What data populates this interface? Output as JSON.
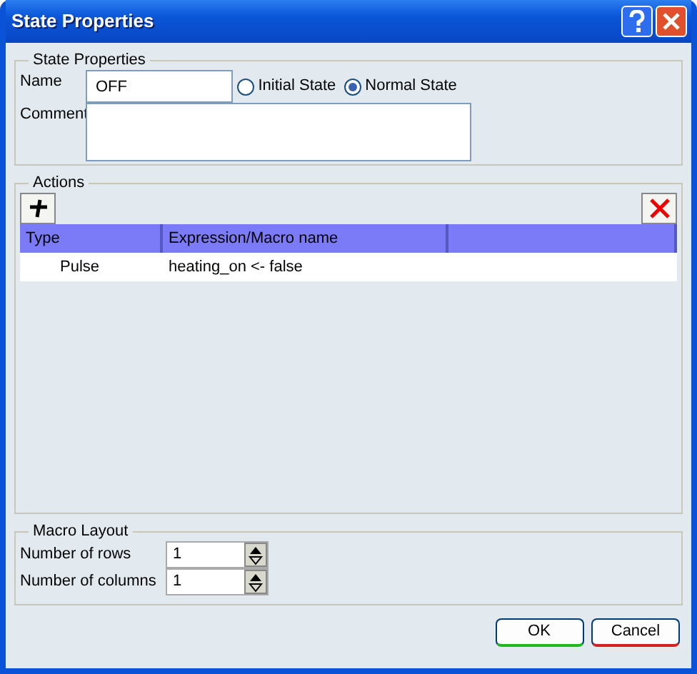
{
  "window": {
    "title": "State Properties"
  },
  "state_properties": {
    "title": "State Properties",
    "name_label": "Name",
    "name_value": "OFF",
    "comment_label": "Comment",
    "radios": [
      {
        "label": "Initial State",
        "selected": false
      },
      {
        "label": "Normal State",
        "selected": true
      }
    ]
  },
  "actions": {
    "title": "Actions",
    "columns": [
      "Type",
      "Expression/Macro name"
    ],
    "rows": [
      {
        "type": "Pulse",
        "expression": "heating_on <- false"
      }
    ]
  },
  "macro_layout": {
    "title": "Macro Layout",
    "fields": [
      {
        "label": "Number of rows",
        "value": "1"
      },
      {
        "label": "Number of columns",
        "value": "1"
      }
    ]
  },
  "buttons": [
    {
      "label": "OK",
      "kind": "ok"
    },
    {
      "label": "Cancel",
      "kind": "cancel"
    }
  ]
}
